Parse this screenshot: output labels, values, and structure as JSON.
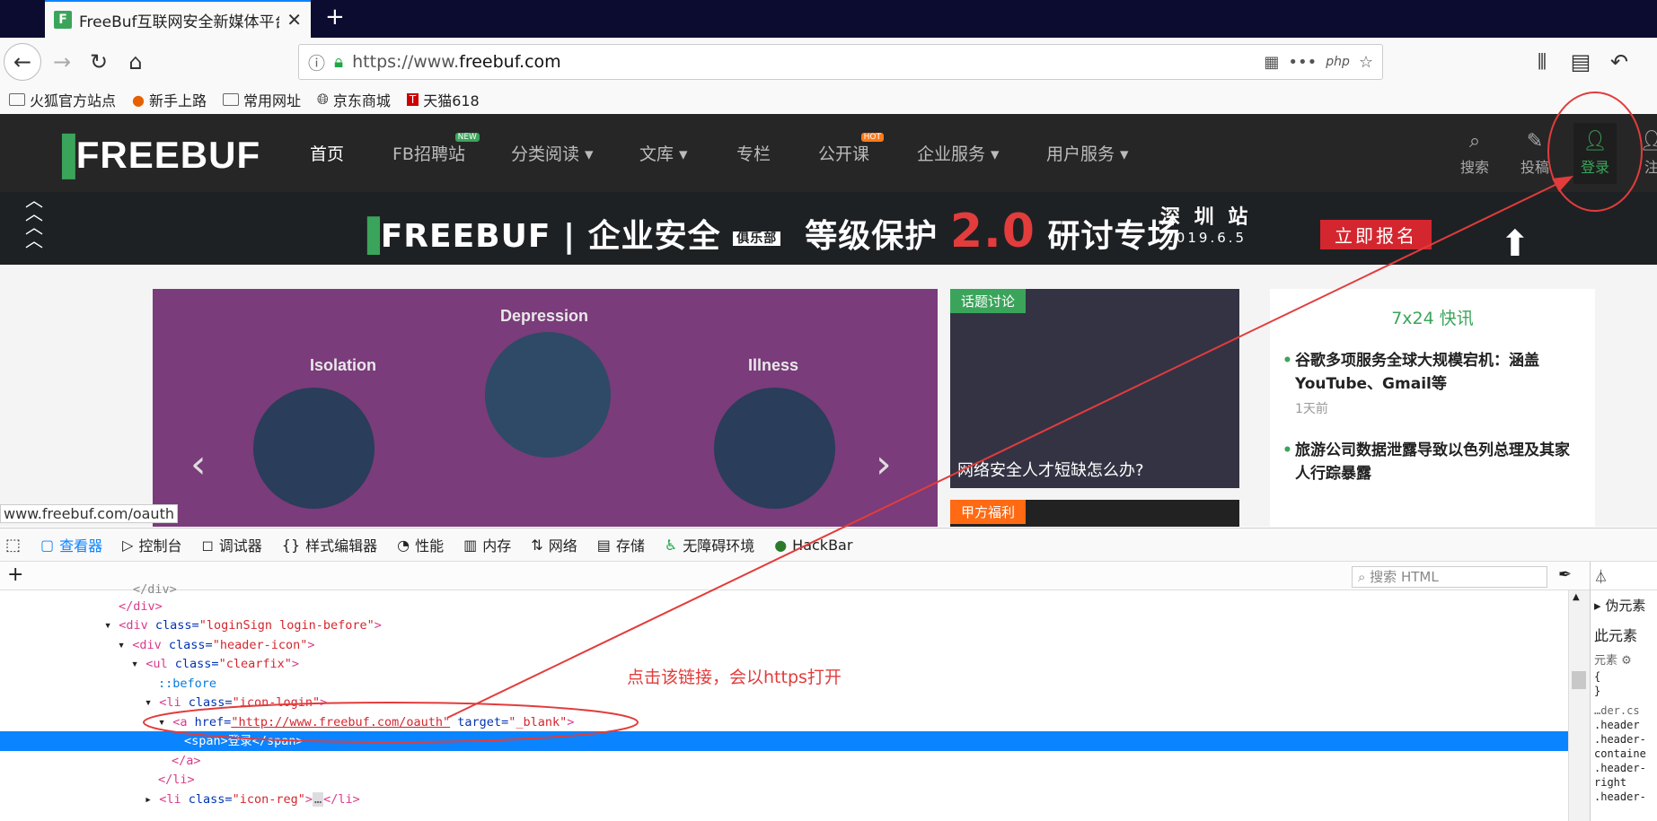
{
  "browser": {
    "tab_title": "FreeBuf互联网安全新媒体平台",
    "new_tab": "+",
    "url_prefix": "https://www.",
    "url_domain": "freebuf.com",
    "url_actions": [
      "•••",
      "php",
      "☆"
    ],
    "bookmarks": [
      "火狐官方站点",
      "新手上路",
      "常用网址",
      "京东商城",
      "天猫618"
    ]
  },
  "site": {
    "logo": "FREEBUF",
    "menu": [
      "首页",
      "FB招聘站",
      "分类阅读",
      "文库",
      "专栏",
      "公开课",
      "企业服务",
      "用户服务"
    ],
    "badges": {
      "new": "NEW",
      "hot": "HOT"
    },
    "top_icons": [
      "搜索",
      "投稿",
      "登录",
      "注"
    ],
    "banner": {
      "brand": "FREEBUF | 企业安全",
      "club": "俱乐部",
      "topic_a": "等级保护",
      "topic_num": "2.0",
      "topic_b": "研讨专场",
      "city": "深 圳 站",
      "date": "2019.6.5",
      "cta": "立即报名"
    },
    "hero_labels": [
      "Isolation",
      "Depression",
      "Illness"
    ],
    "card1": {
      "tag": "话题讨论",
      "caption": "网络安全人才短缺怎么办?"
    },
    "card2": {
      "tag": "甲方福利"
    },
    "news": {
      "title": "7x24 快讯",
      "items": [
        {
          "title": "谷歌多项服务全球大规模宕机：涵盖YouTube、Gmail等",
          "date": "1天前"
        },
        {
          "title": "旅游公司数据泄露导致以色列总理及其家人行踪暴露",
          "date": ""
        }
      ]
    }
  },
  "status_url": "www.freebuf.com/oauth",
  "devtools": {
    "tabs": [
      "查看器",
      "控制台",
      "调试器",
      "样式编辑器",
      "性能",
      "内存",
      "网络",
      "存储",
      "无障碍环境",
      "HackBar"
    ],
    "search_placeholder": "搜索 HTML",
    "tree": [
      "</div>",
      "</div>",
      "<div class=\"loginSign login-before\">",
      "<div class=\"header-icon\">",
      "<ul class=\"clearfix\">",
      "::before",
      "<li class=\"icon-login\">",
      "<a href=\"http://www.freebuf.com/oauth\" target=\"_blank\">",
      "<span>登录</span>",
      "</a>",
      "</li>",
      "<li class=\"icon-reg\">…</li>"
    ],
    "side": {
      "pseudo": "伪元素",
      "this_el": "此元素",
      "el_label": "元素",
      "rules": [
        "{",
        "}",
        "…der.cs",
        ".header",
        ".header-",
        "containe",
        ".header-",
        "right",
        ".header-"
      ]
    }
  },
  "annotation": "点击该链接，会以https打开",
  "colors": {
    "accent": "#3aa55a",
    "dev_select": "#0a84ff",
    "annotation": "#e23c3c"
  }
}
